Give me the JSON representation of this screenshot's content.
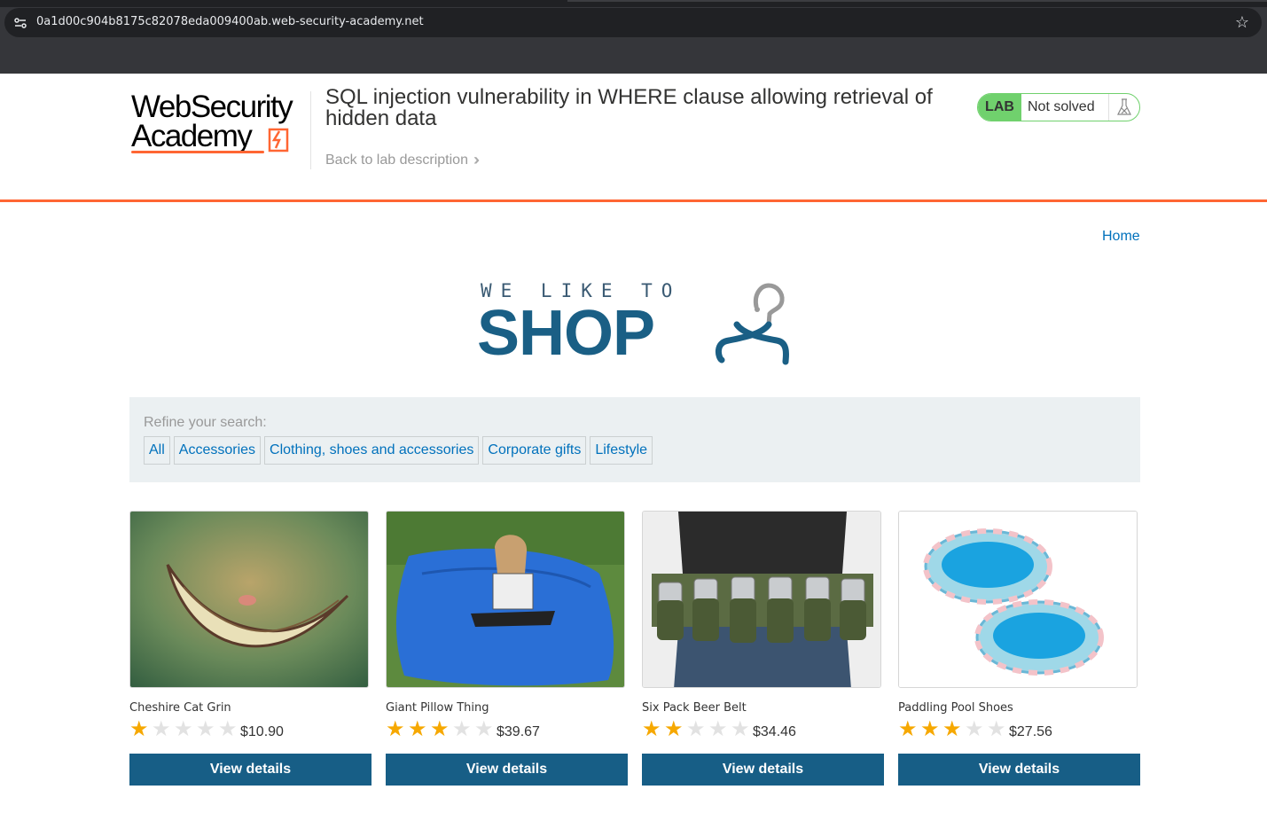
{
  "browser": {
    "url": "0a1d00c904b8175c82078eda009400ab.web-security-academy.net"
  },
  "header": {
    "logo_line1": "WebSecurity",
    "logo_line2": "Academy",
    "lab_title": "SQL injection vulnerability in WHERE clause allowing retrieval of hidden data",
    "back_link": "Back to lab description",
    "lab_badge": "LAB",
    "lab_status": "Not solved",
    "status_color": "#70d16d",
    "accent_color": "#ff6633"
  },
  "nav": {
    "home": "Home"
  },
  "shop_logo": {
    "tagline": "WE LIKE TO",
    "word": "SHOP"
  },
  "filters": {
    "label": "Refine your search:",
    "items": [
      "All",
      "Accessories",
      "Clothing, shoes and accessories",
      "Corporate gifts",
      "Lifestyle"
    ]
  },
  "products": [
    {
      "name": "Cheshire Cat Grin",
      "rating": 1,
      "price": "$10.90",
      "button": "View details",
      "image": "cheshire-cat-grin-image"
    },
    {
      "name": "Giant Pillow Thing",
      "rating": 3,
      "price": "$39.67",
      "button": "View details",
      "image": "giant-pillow-image"
    },
    {
      "name": "Six Pack Beer Belt",
      "rating": 2,
      "price": "$34.46",
      "button": "View details",
      "image": "beer-belt-image"
    },
    {
      "name": "Paddling Pool Shoes",
      "rating": 3,
      "price": "$27.56",
      "button": "View details",
      "image": "paddling-pool-image"
    }
  ]
}
